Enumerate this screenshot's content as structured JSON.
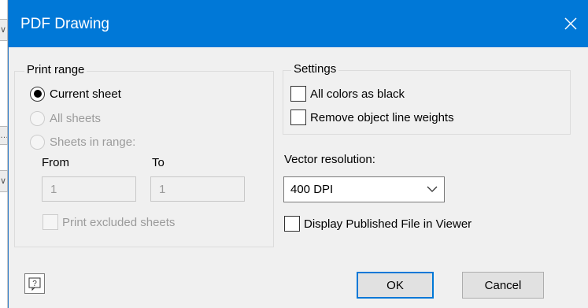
{
  "dialog": {
    "title": "PDF Drawing"
  },
  "background": {
    "dropdown_glyph": "∨",
    "ellipsis_glyph": "…"
  },
  "print_range": {
    "legend": "Print range",
    "options": [
      "Current sheet",
      "All sheets",
      "Sheets in range:"
    ],
    "selected": "Current sheet",
    "from_label": "From",
    "to_label": "To",
    "from_value": "1",
    "to_value": "1",
    "print_excluded_label": "Print excluded sheets"
  },
  "settings": {
    "legend": "Settings",
    "all_colors_black_label": "All colors as black",
    "remove_line_weights_label": "Remove object line weights"
  },
  "vector_resolution": {
    "label": "Vector resolution:",
    "value": "400 DPI"
  },
  "display_published_label": "Display Published File in Viewer",
  "buttons": {
    "ok": "OK",
    "cancel": "Cancel"
  },
  "icons": {
    "close": "close-icon",
    "help": "help-icon",
    "chevron": "chevron-down-icon"
  },
  "colors": {
    "titlebar": "#0078d7",
    "dialog_bg": "#f0f0f0",
    "default_button_border": "#0078d7"
  }
}
